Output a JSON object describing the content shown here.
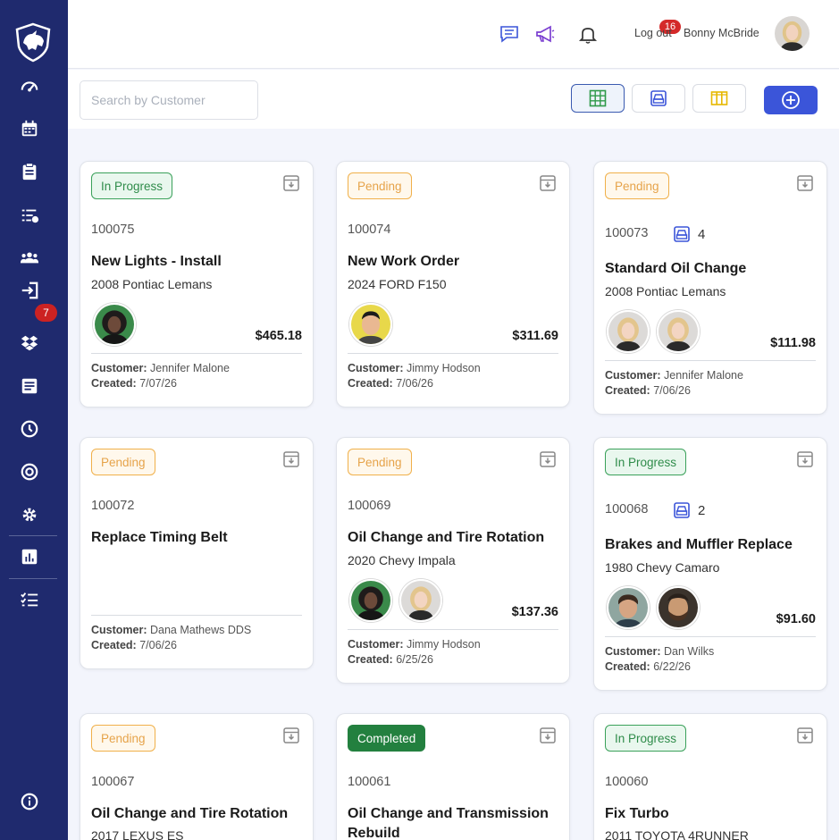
{
  "header": {
    "logout_label": "Log out",
    "user_name": "Bonny McBride",
    "notification_count": "16",
    "icons": [
      "chat-icon",
      "megaphone-icon",
      "bell-icon"
    ]
  },
  "sidebar": {
    "items": [
      {
        "icon": "dashboard-icon"
      },
      {
        "icon": "calendar-icon"
      },
      {
        "icon": "clipboard-icon"
      },
      {
        "icon": "task-list-icon"
      },
      {
        "icon": "customers-icon"
      },
      {
        "icon": "login-icon"
      },
      {
        "icon": "dropbox-icon"
      },
      {
        "icon": "document-icon"
      },
      {
        "icon": "clock-icon"
      },
      {
        "icon": "target-icon"
      },
      {
        "icon": "settings-icon"
      },
      {
        "icon": "reports-icon"
      },
      {
        "icon": "checklist-icon"
      },
      {
        "icon": "info-icon"
      }
    ],
    "badge": "7"
  },
  "toolbar": {
    "search_placeholder": "Search by Customer",
    "views": [
      "grid-view-icon",
      "vehicle-view-icon",
      "column-view-icon"
    ],
    "add_icon": "plus-circle-icon"
  },
  "colors": {
    "sidebar": "#1f2a6e",
    "accent": "#3b55d9",
    "in_progress": "#2f8c4a",
    "pending": "#e6a34a",
    "completed": "#23803f",
    "badge": "#d42a2a"
  },
  "cards": [
    {
      "status": "In Progress",
      "order": "100075",
      "title": "New Lights - Install",
      "vehicle": "2008 Pontiac Lemans",
      "price": "$465.18",
      "customer_label": "Customer:",
      "customer": " Jennifer Malone",
      "created_label": "Created:",
      "created": " 7/07/26"
    },
    {
      "status": "Pending",
      "order": "100074",
      "title": "New Work Order",
      "vehicle": "2024 FORD F150",
      "price": "$311.69",
      "customer_label": "Customer:",
      "customer": " Jimmy Hodson",
      "created_label": "Created:",
      "created": " 7/06/26"
    },
    {
      "status": "Pending",
      "order": "100073",
      "vehicle_count": "4",
      "title": "Standard Oil Change",
      "vehicle": "2008 Pontiac Lemans",
      "price": "$111.98",
      "customer_label": "Customer:",
      "customer": " Jennifer Malone",
      "created_label": "Created:",
      "created": " 7/06/26"
    },
    {
      "status": "Pending",
      "order": "100072",
      "title": "Replace Timing Belt",
      "customer_label": "Customer:",
      "customer": " Dana Mathews DDS",
      "created_label": "Created:",
      "created": " 7/06/26"
    },
    {
      "status": "Pending",
      "order": "100069",
      "title": "Oil Change and Tire Rotation",
      "vehicle": "2020 Chevy Impala",
      "price": "$137.36",
      "customer_label": "Customer:",
      "customer": " Jimmy Hodson",
      "created_label": "Created:",
      "created": " 6/25/26"
    },
    {
      "status": "In Progress",
      "order": "100068",
      "vehicle_count": "2",
      "title": "Brakes and Muffler Replace",
      "vehicle": "1980 Chevy Camaro",
      "price": "$91.60",
      "customer_label": "Customer:",
      "customer": " Dan Wilks",
      "created_label": "Created:",
      "created": " 6/22/26"
    },
    {
      "status": "Pending",
      "order": "100067",
      "title": "Oil Change and Tire Rotation",
      "vehicle": "2017 LEXUS ES"
    },
    {
      "status": "Completed",
      "order": "100061",
      "title": "Oil Change and Transmission",
      "title_line2": "Rebuild"
    },
    {
      "status": "In Progress",
      "order": "100060",
      "title": "Fix Turbo",
      "vehicle": "2011 TOYOTA 4RUNNER"
    }
  ]
}
